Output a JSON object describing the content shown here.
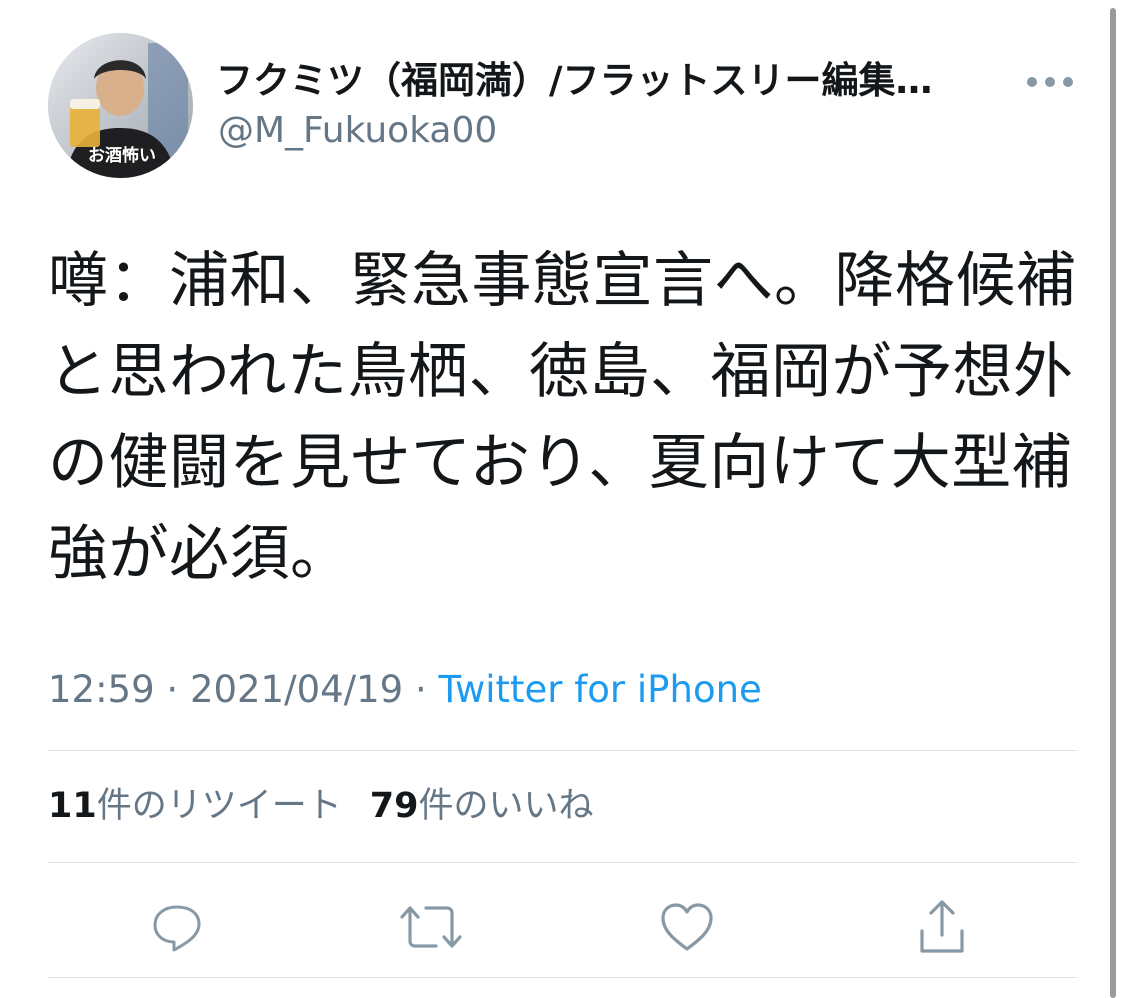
{
  "author": {
    "display_name": "フクミツ（福岡満）/フラットスリー編集…",
    "handle": "@M_Fukuoka00",
    "avatar_caption": "お酒怖い"
  },
  "tweet": {
    "text": "噂：浦和、緊急事態宣言へ。降格候補と思われた鳥栖、徳島、福岡が予想外の健闘を見せており、夏向けて大型補強が必須。"
  },
  "meta": {
    "time": "12:59",
    "sep1": " · ",
    "date": "2021/04/19",
    "sep2": " · ",
    "source": "Twitter for iPhone"
  },
  "stats": {
    "retweets_count": "11",
    "retweets_label": "件のリツイート",
    "likes_count": "79",
    "likes_label": "件のいいね"
  },
  "actions": {
    "reply": "reply-icon",
    "retweet": "retweet-icon",
    "like": "heart-icon",
    "share": "share-icon"
  },
  "colors": {
    "text": "#14171a",
    "secondary": "#657786",
    "link": "#1d9bf0",
    "icon": "#8899a6",
    "divider": "#dfe3e8"
  }
}
